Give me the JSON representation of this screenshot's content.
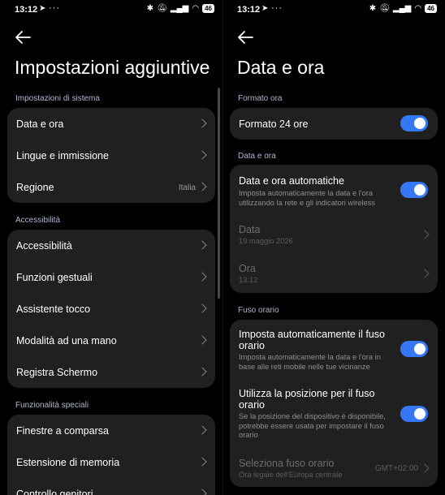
{
  "left": {
    "status": {
      "time": "13:12",
      "telegram": "◢",
      "dots": "···",
      "battery": "46"
    },
    "title": "Impostazioni aggiuntive",
    "sections": [
      {
        "label": "Impostazioni di sistema",
        "items": [
          {
            "label": "Data e ora"
          },
          {
            "label": "Lingue e immissione"
          },
          {
            "label": "Regione",
            "value": "Italia"
          }
        ]
      },
      {
        "label": "Accessibilità",
        "items": [
          {
            "label": "Accessibilità"
          },
          {
            "label": "Funzioni gestuali"
          },
          {
            "label": "Assistente tocco"
          },
          {
            "label": "Modalità ad una mano"
          },
          {
            "label": "Registra Schermo"
          }
        ]
      },
      {
        "label": "Funzionalità speciali",
        "items": [
          {
            "label": "Finestre a comparsa"
          },
          {
            "label": "Estensione di memoria"
          },
          {
            "label": "Controllo genitori"
          }
        ]
      }
    ]
  },
  "right": {
    "status": {
      "time": "13:12",
      "telegram": "◢",
      "dots": "···",
      "battery": "46"
    },
    "title": "Data e ora",
    "sections": [
      {
        "label": "Formato ora",
        "items": [
          {
            "label": "Formato 24 ore",
            "toggle": true
          }
        ]
      },
      {
        "label": "Data e ora",
        "items": [
          {
            "label": "Data e ora automatiche",
            "sub": "Imposta automaticamente la data e l'ora utilizzando la rete e gli indicatori wireless",
            "toggle": true
          },
          {
            "label": "Data",
            "sub": "19 maggio 2026",
            "disabled": true
          },
          {
            "label": "Ora",
            "sub": "13:12",
            "disabled": true
          }
        ]
      },
      {
        "label": "Fuso orario",
        "items": [
          {
            "label": "Imposta automaticamente il fuso orario",
            "sub": "Imposta automaticamente la data e l'ora in base alle reti mobile nelle tue vicinanze",
            "toggle": true
          },
          {
            "label": "Utilizza la posizione per il fuso orario",
            "sub": "Se la posizione del dispositivo è disponibile, potrebbe essere usata per impostare il fuso orario",
            "toggle": true
          },
          {
            "label": "Seleziona fuso orario",
            "sub": "Ora legale dell'Europa centrale",
            "value": "GMT+02:00",
            "disabled": true
          }
        ]
      }
    ]
  }
}
